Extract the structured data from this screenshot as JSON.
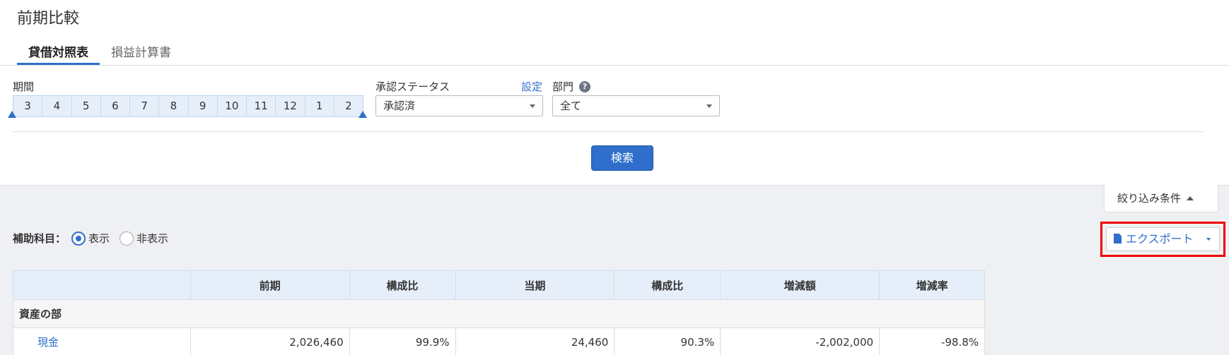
{
  "page": {
    "title": "前期比較"
  },
  "tabs": [
    {
      "label": "貸借対照表",
      "active": true
    },
    {
      "label": "損益計算書",
      "active": false
    }
  ],
  "filters": {
    "period_label": "期間",
    "months": [
      "3",
      "4",
      "5",
      "6",
      "7",
      "8",
      "9",
      "10",
      "11",
      "12",
      "1",
      "2"
    ],
    "approval_label": "承認ステータス",
    "approval_settings_link": "設定",
    "approval_value": "承認済",
    "dept_label": "部門",
    "dept_help": "?",
    "dept_value": "全て",
    "search_label": "検索"
  },
  "results": {
    "filter_toggle_label": "絞り込み条件",
    "sub_account_label": "補助科目：",
    "radio_show": "表示",
    "radio_hide": "非表示",
    "radio_selected": "show",
    "export_label": "エクスポート"
  },
  "table": {
    "headers": [
      "",
      "前期",
      "構成比",
      "当期",
      "構成比",
      "増減額",
      "増減率"
    ],
    "section_assets": "資産の部",
    "rows": [
      {
        "name": "現金",
        "prev": "2,026,460",
        "prev_ratio": "99.9%",
        "curr": "24,460",
        "curr_ratio": "90.3%",
        "diff": "-2,002,000",
        "diff_rate": "-98.8%"
      }
    ]
  },
  "colors": {
    "accent": "#2f6fcb",
    "highlight": "#e00000",
    "gray_bg": "#eff0f3",
    "header_bg": "#e6eff9"
  }
}
